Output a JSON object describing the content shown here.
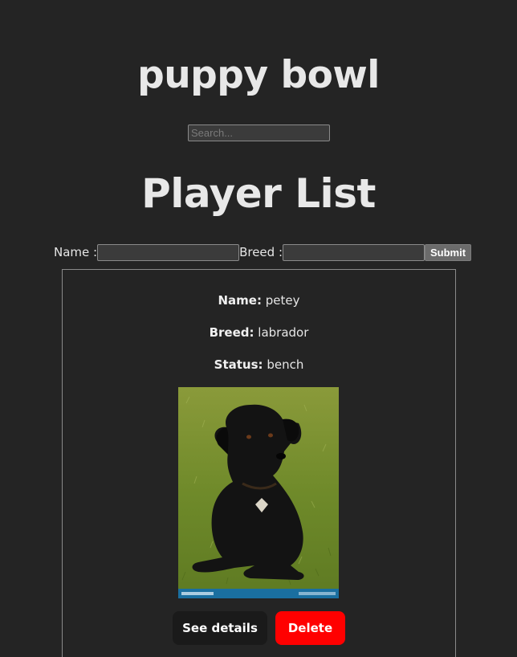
{
  "header": {
    "title": "puppy bowl"
  },
  "search": {
    "placeholder": "Search..."
  },
  "list": {
    "title": "Player List"
  },
  "form": {
    "name_label": "Name :",
    "breed_label": "Breed :",
    "submit_label": "Submit"
  },
  "players": [
    {
      "name_label": "Name:",
      "name": "petey",
      "breed_label": "Breed:",
      "breed": "labrador",
      "status_label": "Status:",
      "status": "bench",
      "image_alt": "black labrador lying on grass",
      "details_label": "See details",
      "delete_label": "Delete"
    }
  ],
  "colors": {
    "background": "#242424",
    "delete_button": "#ff0000",
    "details_button": "#1a1a1a"
  }
}
